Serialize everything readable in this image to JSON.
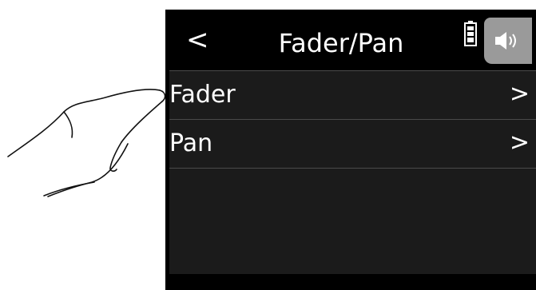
{
  "screen": {
    "title": "Fader/Pan",
    "back_label": "<",
    "icons": {
      "back": "back-arrow-icon",
      "battery": "battery-icon",
      "speaker": "speaker-icon"
    }
  },
  "menu": {
    "items": [
      {
        "label": "Fader",
        "chevron": ">"
      },
      {
        "label": "Pan",
        "chevron": ">"
      }
    ]
  },
  "colors": {
    "background": "#000000",
    "list_background": "#1b1b1b",
    "divider": "#4a4a4a",
    "speaker_button": "#9a9a9a",
    "text": "#ffffff"
  }
}
